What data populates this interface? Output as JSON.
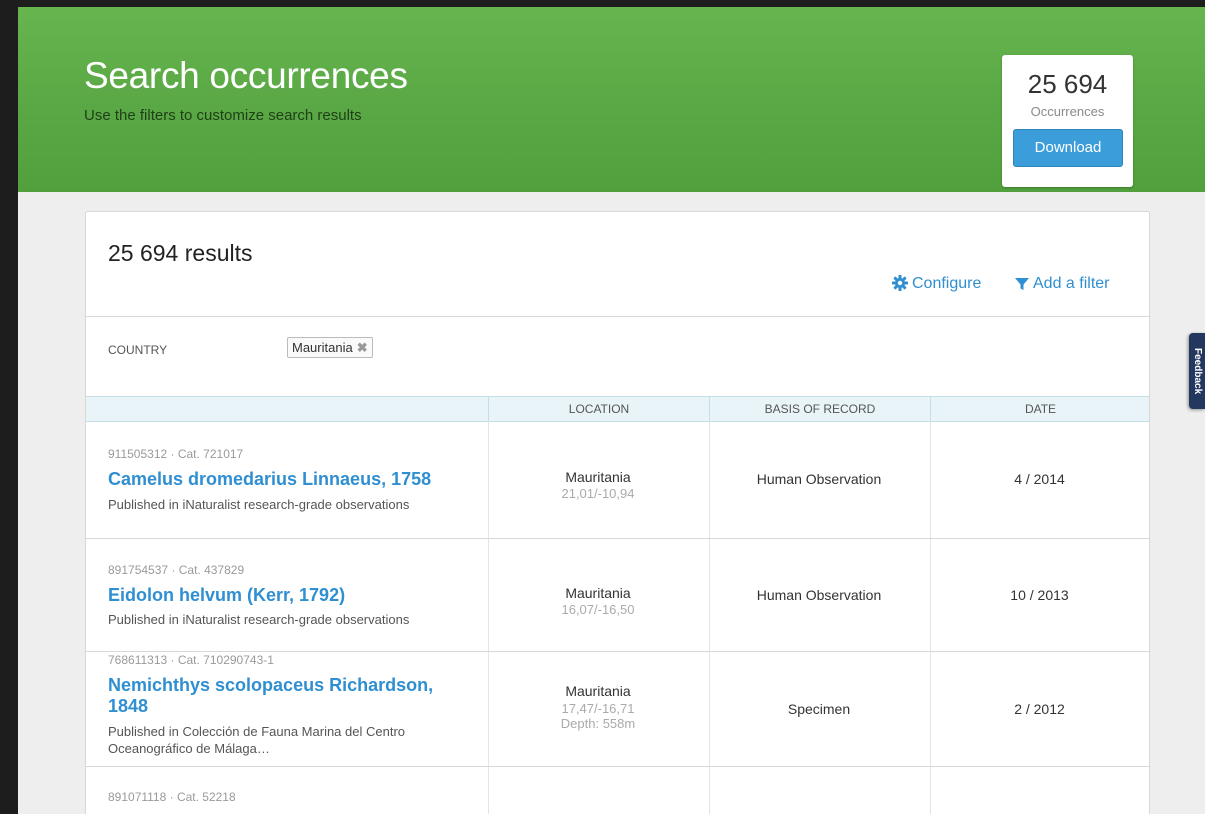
{
  "header": {
    "title": "Search occurrences",
    "subtitle": "Use the filters to customize search results"
  },
  "summary": {
    "count": "25 694",
    "label": "Occurrences",
    "download_label": "Download"
  },
  "feedback_label": "Feedback",
  "results": {
    "title": "25 694 results",
    "configure_label": "Configure",
    "add_filter_label": "Add a filter"
  },
  "filters": [
    {
      "label": "COUNTRY",
      "value": "Mauritania"
    }
  ],
  "table": {
    "columns": [
      "",
      "LOCATION",
      "BASIS OF RECORD",
      "DATE"
    ],
    "rows": [
      {
        "id": "911505312 · Cat. 721017",
        "name": "Camelus dromedarius Linnaeus, 1758",
        "published": "Published in iNaturalist research-grade observations",
        "country": "Mauritania",
        "coords": "21,01/-10,94",
        "depth": "",
        "basis": "Human Observation",
        "date": "4 / 2014"
      },
      {
        "id": "891754537 · Cat. 437829",
        "name": "Eidolon helvum (Kerr, 1792)",
        "published": "Published in iNaturalist research-grade observations",
        "country": "Mauritania",
        "coords": "16,07/-16,50",
        "depth": "",
        "basis": "Human Observation",
        "date": "10 / 2013"
      },
      {
        "id": "768611313 · Cat. 710290743-1",
        "name": "Nemichthys scolopaceus Richardson, 1848",
        "published": "Published in Colección de Fauna Marina del Centro Oceanográfico de Málaga…",
        "country": "Mauritania",
        "coords": "17,47/-16,71",
        "depth": "Depth: 558m",
        "basis": "Specimen",
        "date": "2 / 2012"
      },
      {
        "id": "891071118 · Cat. 52218"
      }
    ]
  },
  "colors": {
    "header_green": "#5aa845",
    "link_blue": "#2f8fd1",
    "button_blue": "#3b9dd9",
    "table_header_bg": "#e8f4f8",
    "feedback_tab": "#24375f"
  }
}
